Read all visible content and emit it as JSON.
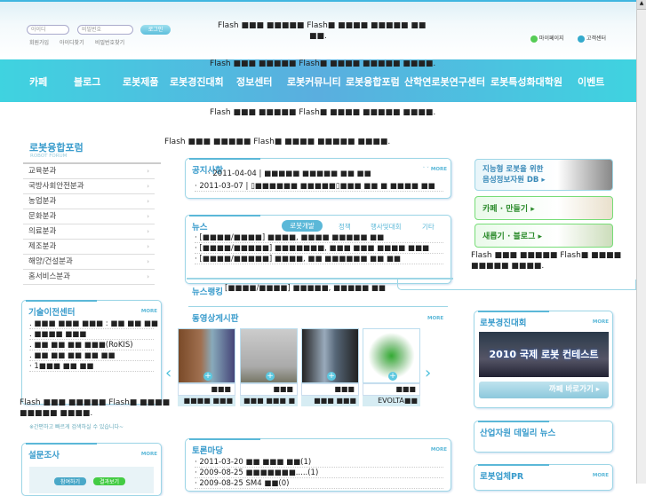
{
  "flash_notice": "Flash ■■■ ■■■■■ Flash■ ■■■■ ■■■■■ ■■■■.",
  "header": {
    "id_placeholder": "아이디",
    "pw_placeholder": "비밀번호",
    "login": "로그인",
    "links": [
      "회원가입",
      "아이디찾기",
      "비밀번호찾기"
    ],
    "flash_line1": "Flash ■■■ ■■■■■ Flash■ ■■■■ ■■■■■ ■■",
    "flash_line2": "■■.",
    "mypage": "마이페이지",
    "support": "고객센터"
  },
  "nav": [
    "카페",
    "블로그",
    "로봇제품",
    "로봇경진대회",
    "정보센터",
    "로봇커뮤니티",
    "로봇융합포럼",
    "산학연로봇연구센터",
    "로봇특성화대학원",
    "이벤트"
  ],
  "sidebar": {
    "title": "로봇융합포럼",
    "subtitle": "ROBOT FORUM",
    "items": [
      "교육분과",
      "국방사회안전분과",
      "농업분과",
      "문화분과",
      "의료분과",
      "제조분과",
      "해양/건설분과",
      "홈서비스분과"
    ]
  },
  "tech": {
    "title": "기술이전센터",
    "more": "MORE",
    "rows": [
      ". ■■■ ■■■ ■■■ : ■■ ■■ ■■",
      ". ■■■■ ■■■",
      ". ■■ ■■ ■■ ■■■(RoKIS)",
      ". ■■ ■■ ■■ ■■ ■■",
      "· 1■■■ ■■ ■■"
    ]
  },
  "left_flash": {
    "line1": "Flash ■■■ ■■■■■ Flash■ ■■■■",
    "line2": "■■■■■ ■■■■.",
    "note": "※간편하고 빠르게 검색하실 수 있습니다~"
  },
  "survey": {
    "title": "설문조사",
    "more": "MORE",
    "join": "참여하기",
    "result": "결과보기"
  },
  "notice": {
    "title": "공지사항",
    "more": "MORE",
    "rows": [
      "· 2011-04-04 | ■■■■■ ■■■■■ ■■ ■■",
      "· 2011-03-07 | ▯■■■■■■ ■■■■■▯■■■ ■■ ■ ■■■■ ■■"
    ]
  },
  "news": {
    "title": "뉴스",
    "tabs": [
      "로봇개발",
      "정책",
      "행사및대회",
      "기타"
    ],
    "rows": [
      "· [■■■■/■■■■] ■■■■, ■■■■ ■■■■■ ■■",
      "· [■■■■/■■■■■] ■■■■■■■, ■■■ ■■■ ■■■■ ■■■",
      "· [■■■■/■■■■■] ■■■■, ■■ ■■■■■■ ■■ ■■"
    ]
  },
  "ranking": {
    "title": "뉴스랭킹",
    "text": "[■■■■/■■■■] ■■■■■, ■■■■■ ■■"
  },
  "video": {
    "title": "동영상게시판",
    "more": "MORE",
    "items": [
      {
        "top": "■■■",
        "bottom": "■■■■ ■■■"
      },
      {
        "top": "■■■",
        "bottom": "■■■ ■■■ ■"
      },
      {
        "top": "■■■",
        "bottom": "■■■ ■■■"
      },
      {
        "top": "■■■",
        "bottom": "EVOLTA■■"
      }
    ]
  },
  "debate": {
    "title": "토론마당",
    "more": "MORE",
    "rows": [
      "· 2011-03-20 ■■ ■■■ ■■(1)",
      "· 2009-08-25 ■■■■■■■.....(1)",
      "· 2009-08-25 SM4 ■■(0)"
    ]
  },
  "right": {
    "banner1_l1": "지능형 로봇을 위한",
    "banner1_l2": "음성정보자원 DB ▸",
    "banner2": "카페 · 만들기 ▸",
    "banner3": "새롭기 · 블로그 ▸",
    "flash1": "Flash ■■■ ■■■■■ Flash■ ■■■■",
    "flash2": "■■■■■ ■■■■.",
    "contest_title": "로봇경진대회",
    "contest_more": "MORE",
    "contest_banner": "2010 국제 로봇 컨테스트",
    "cafe_go": "까페 바로가기 ▸",
    "daily": "산업자원 데일리 뉴스",
    "pr": "로봇업체PR",
    "pr_more": "MORE"
  }
}
